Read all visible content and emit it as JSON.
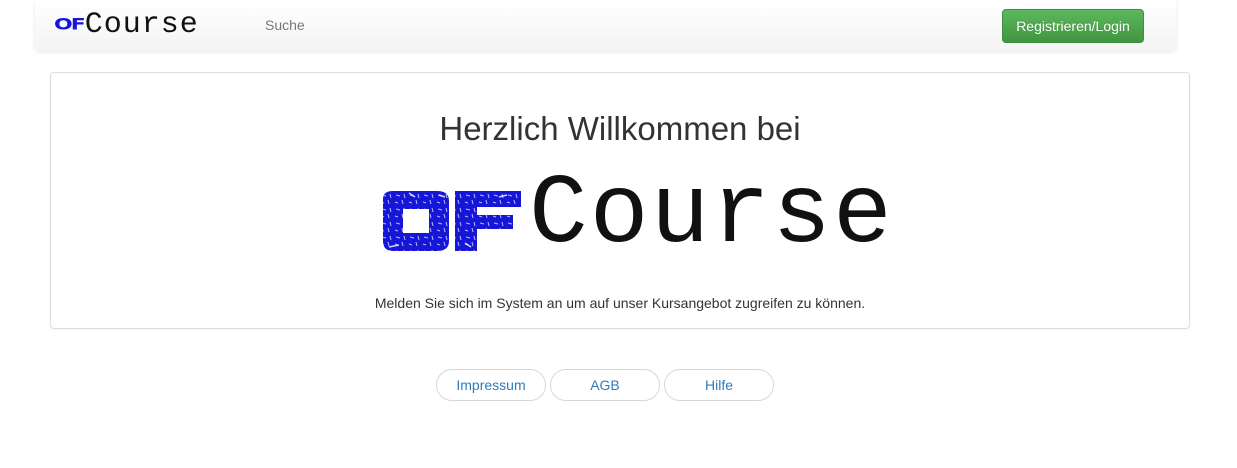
{
  "navbar": {
    "brand": {
      "logo_mark": "OF",
      "logo_word": "Course"
    },
    "search_link": "Suche",
    "login_button": "Registrieren/Login"
  },
  "welcome": {
    "title": "Herzlich Willkommen bei",
    "logo": {
      "mark": "OF",
      "word": "Course"
    },
    "message": "Melden Sie sich im System an um auf unser Kursangebot zugreifen zu können."
  },
  "footer": {
    "links": [
      "Impressum",
      "AGB",
      "Hilfe"
    ]
  },
  "colors": {
    "logo_blue": "#1616d9",
    "login_green": "#5cb85c",
    "link_blue": "#337ab7"
  }
}
